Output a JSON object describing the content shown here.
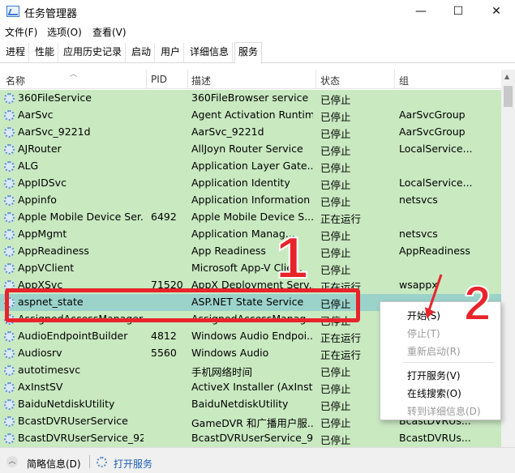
{
  "window": {
    "title": "任务管理器",
    "min_glyph": "—",
    "max_glyph": "☐",
    "close_glyph": "✕"
  },
  "menu": [
    "文件(F)",
    "选项(O)",
    "查看(V)"
  ],
  "tabs": [
    "进程",
    "性能",
    "应用历史记录",
    "启动",
    "用户",
    "详细信息",
    "服务"
  ],
  "active_tab": "服务",
  "columns": [
    "名称",
    "PID",
    "描述",
    "状态",
    "组"
  ],
  "rows": [
    {
      "name": "360FileService",
      "pid": "",
      "desc": "360FileBrowser service",
      "status": "已停止",
      "group": ""
    },
    {
      "name": "AarSvc",
      "pid": "",
      "desc": "Agent Activation Runtime",
      "status": "已停止",
      "group": "AarSvcGroup"
    },
    {
      "name": "AarSvc_9221d",
      "pid": "",
      "desc": "AarSvc_9221d",
      "status": "已停止",
      "group": "AarSvcGroup"
    },
    {
      "name": "AJRouter",
      "pid": "",
      "desc": "AllJoyn Router Service",
      "status": "已停止",
      "group": "LocalService..."
    },
    {
      "name": "ALG",
      "pid": "",
      "desc": "Application Layer Gate...",
      "status": "已停止",
      "group": ""
    },
    {
      "name": "AppIDSvc",
      "pid": "",
      "desc": "Application Identity",
      "status": "已停止",
      "group": "LocalService..."
    },
    {
      "name": "Appinfo",
      "pid": "",
      "desc": "Application Information",
      "status": "已停止",
      "group": "netsvcs"
    },
    {
      "name": "Apple Mobile Device Ser...",
      "pid": "6492",
      "desc": "Apple Mobile Device S...",
      "status": "正在运行",
      "group": ""
    },
    {
      "name": "AppMgmt",
      "pid": "",
      "desc": "Application Manag...",
      "status": "已停止",
      "group": "netsvcs"
    },
    {
      "name": "AppReadiness",
      "pid": "",
      "desc": "App Readiness",
      "status": "已停止",
      "group": "AppReadiness"
    },
    {
      "name": "AppVClient",
      "pid": "",
      "desc": "Microsoft App-V Clie...",
      "status": "已停止",
      "group": ""
    },
    {
      "name": "AppXSvc",
      "pid": "71520",
      "desc": "AppX Deployment Serv...",
      "status": "正在运行",
      "group": "wsappx"
    },
    {
      "name": "aspnet_state",
      "pid": "",
      "desc": "ASP.NET State Service",
      "status": "已停止",
      "group": ""
    },
    {
      "name": "AssignedAccessManager...",
      "pid": "",
      "desc": "AssignedAccessManag...",
      "status": "已停止",
      "group": ""
    },
    {
      "name": "AudioEndpointBuilder",
      "pid": "4812",
      "desc": "Windows Audio Endpoi...",
      "status": "正在运行",
      "group": ""
    },
    {
      "name": "Audiosrv",
      "pid": "5560",
      "desc": "Windows Audio",
      "status": "正在运行",
      "group": ""
    },
    {
      "name": "autotimesvc",
      "pid": "",
      "desc": "手机网络时间",
      "status": "已停止",
      "group": ""
    },
    {
      "name": "AxInstSV",
      "pid": "",
      "desc": "ActiveX Installer (AxInst...",
      "status": "已停止",
      "group": ""
    },
    {
      "name": "BaiduNetdiskUtility",
      "pid": "",
      "desc": "BaiduNetdiskUtility",
      "status": "已停止",
      "group": ""
    },
    {
      "name": "BcastDVRUserService",
      "pid": "",
      "desc": "GameDVR 和广播用户服...",
      "status": "已停止",
      "group": "BcastDVRUs..."
    },
    {
      "name": "BcastDVRUserService_92...",
      "pid": "",
      "desc": "BcastDVRUserService_9...",
      "status": "已停止",
      "group": "BcastDVRUs..."
    }
  ],
  "selected_row": 12,
  "context_menu": {
    "items": [
      {
        "label": "开始(S)",
        "enabled": true
      },
      {
        "label": "停止(T)",
        "enabled": false
      },
      {
        "label": "重新启动(R)",
        "enabled": false
      },
      {
        "label": "打开服务(V)",
        "enabled": true
      },
      {
        "label": "在线搜索(O)",
        "enabled": true
      },
      {
        "label": "转到详细信息(D)",
        "enabled": false
      }
    ]
  },
  "footer": {
    "details_label": "简略信息(D)",
    "open_services_label": "打开服务"
  },
  "annotations": {
    "step1": "1",
    "step2": "2",
    "color": "#e8242b"
  }
}
